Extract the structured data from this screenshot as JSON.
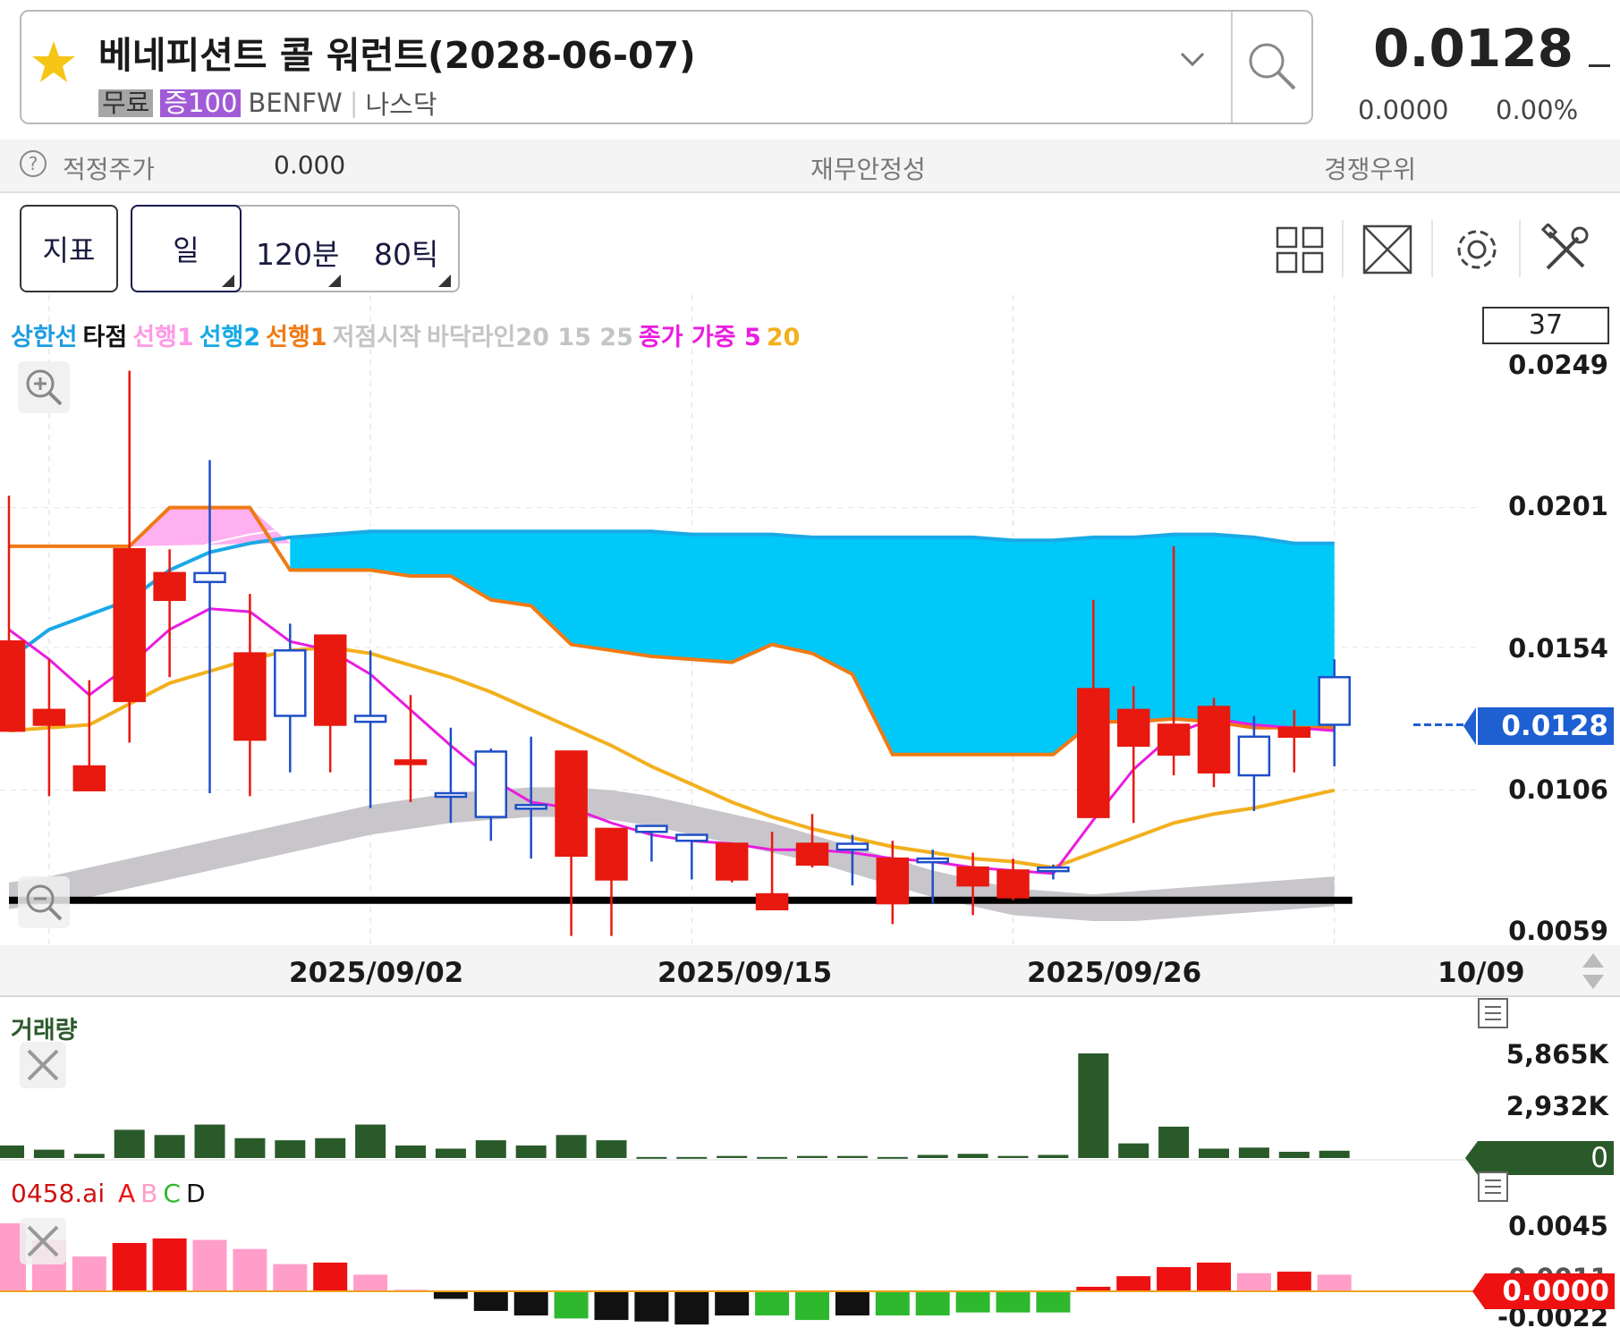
{
  "header": {
    "stock_name": "베네피션트 콜 워런트(2028-06-07)",
    "badge_free": "무료",
    "badge_margin": "증100",
    "ticker": "BENFW",
    "exchange": "나스닥",
    "price": "0.0128",
    "change_abs": "0.0000",
    "change_pct": "0.00%"
  },
  "info_strip": {
    "fair_value_label": "적정주가",
    "fair_value": "0.000",
    "financial_stability": "재무안정성",
    "competitive_edge": "경쟁우위"
  },
  "toolbar": {
    "indicator": "지표",
    "day": "일",
    "min120": "120분",
    "tick80": "80틱"
  },
  "legend": [
    {
      "text": "상한선",
      "color": "#1e9be0"
    },
    {
      "text": "타점",
      "color": "#111111"
    },
    {
      "text": "선행1",
      "color": "#ff99e6"
    },
    {
      "text": "선행2",
      "color": "#15a9e6"
    },
    {
      "text": "선행1",
      "color": "#f07a14"
    },
    {
      "text": "저점시작",
      "color": "#c4c4c4"
    },
    {
      "text": "바닥라인20 15 25",
      "color": "#c4c4c4"
    },
    {
      "text": "종가 가중 5",
      "color": "#ea1ce0"
    },
    {
      "text": "20",
      "color": "#f2b01e"
    }
  ],
  "candle_count": "37",
  "price_axis": [
    "0.0249",
    "0.0201",
    "0.0154",
    "0.0106",
    "0.0059"
  ],
  "current_price_tag": "0.0128",
  "date_axis": [
    "2025/09/02",
    "2025/09/15",
    "2025/09/26",
    "10/09"
  ],
  "volume": {
    "title": "거래량",
    "axis": [
      "5,865K",
      "2,932K",
      "0"
    ],
    "tag": "0"
  },
  "ai_panel": {
    "title_prefix": "0458.ai",
    "labels": [
      {
        "t": "A",
        "c": "#ee1111"
      },
      {
        "t": "B",
        "c": "#ff9ec8"
      },
      {
        "t": "C",
        "c": "#2eb82e"
      },
      {
        "t": "D",
        "c": "#111111"
      }
    ],
    "axis": [
      "0.0045",
      "0.0011",
      "-0.0022"
    ],
    "tag": "0.0000"
  },
  "chart_data": {
    "type": "candlestick",
    "price_range": [
      0.0059,
      0.0249
    ],
    "candles": [
      {
        "o": 0.0156,
        "h": 0.0205,
        "l": 0.0126,
        "c": 0.0126
      },
      {
        "o": 0.0133,
        "h": 0.015,
        "l": 0.0104,
        "c": 0.0128
      },
      {
        "o": 0.0114,
        "h": 0.0143,
        "l": 0.0106,
        "c": 0.0106
      },
      {
        "o": 0.0187,
        "h": 0.0247,
        "l": 0.0122,
        "c": 0.0136
      },
      {
        "o": 0.0179,
        "h": 0.0187,
        "l": 0.0144,
        "c": 0.017
      },
      {
        "o": 0.0176,
        "h": 0.0217,
        "l": 0.0105,
        "c": 0.0179
      },
      {
        "o": 0.0152,
        "h": 0.0172,
        "l": 0.0104,
        "c": 0.0123
      },
      {
        "o": 0.0131,
        "h": 0.0162,
        "l": 0.0112,
        "c": 0.0153
      },
      {
        "o": 0.0158,
        "h": 0.0158,
        "l": 0.0112,
        "c": 0.0128
      },
      {
        "o": 0.0129,
        "h": 0.0153,
        "l": 0.01,
        "c": 0.0131
      },
      {
        "o": 0.0116,
        "h": 0.0138,
        "l": 0.0102,
        "c": 0.0115
      },
      {
        "o": 0.0105,
        "h": 0.0127,
        "l": 0.0095,
        "c": 0.0105
      },
      {
        "o": 0.0097,
        "h": 0.012,
        "l": 0.0089,
        "c": 0.0119
      },
      {
        "o": 0.0101,
        "h": 0.0124,
        "l": 0.0083,
        "c": 0.0101
      },
      {
        "o": 0.0119,
        "h": 0.0119,
        "l": 0.0057,
        "c": 0.0084
      },
      {
        "o": 0.0093,
        "h": 0.0093,
        "l": 0.0057,
        "c": 0.0076
      },
      {
        "o": 0.0092,
        "h": 0.0094,
        "l": 0.0082,
        "c": 0.0094
      },
      {
        "o": 0.0089,
        "h": 0.0091,
        "l": 0.0076,
        "c": 0.0091
      },
      {
        "o": 0.0088,
        "h": 0.0088,
        "l": 0.0075,
        "c": 0.0076
      },
      {
        "o": 0.0071,
        "h": 0.0092,
        "l": 0.0067,
        "c": 0.0066
      },
      {
        "o": 0.0088,
        "h": 0.0098,
        "l": 0.008,
        "c": 0.0081
      },
      {
        "o": 0.0086,
        "h": 0.0091,
        "l": 0.0074,
        "c": 0.0088
      },
      {
        "o": 0.0083,
        "h": 0.0089,
        "l": 0.0061,
        "c": 0.0068
      },
      {
        "o": 0.0083,
        "h": 0.0086,
        "l": 0.0068,
        "c": 0.0083
      },
      {
        "o": 0.008,
        "h": 0.0085,
        "l": 0.0064,
        "c": 0.0074
      },
      {
        "o": 0.0079,
        "h": 0.0083,
        "l": 0.0069,
        "c": 0.007
      },
      {
        "o": 0.0079,
        "h": 0.0081,
        "l": 0.0076,
        "c": 0.008
      },
      {
        "o": 0.014,
        "h": 0.017,
        "l": 0.0099,
        "c": 0.0097
      },
      {
        "o": 0.0133,
        "h": 0.0141,
        "l": 0.0095,
        "c": 0.0121
      },
      {
        "o": 0.0128,
        "h": 0.0188,
        "l": 0.0111,
        "c": 0.0118
      },
      {
        "o": 0.0134,
        "h": 0.0137,
        "l": 0.0107,
        "c": 0.0112
      },
      {
        "o": 0.0111,
        "h": 0.0131,
        "l": 0.0099,
        "c": 0.0124
      },
      {
        "o": 0.0127,
        "h": 0.0133,
        "l": 0.0112,
        "c": 0.0124
      },
      {
        "o": 0.0128,
        "h": 0.015,
        "l": 0.0114,
        "c": 0.0144
      }
    ],
    "volume": [
      0.12,
      0.08,
      0.04,
      0.27,
      0.22,
      0.32,
      0.19,
      0.17,
      0.19,
      0.32,
      0.12,
      0.09,
      0.17,
      0.12,
      0.22,
      0.17,
      0.01,
      0.01,
      0.02,
      0.01,
      0.02,
      0.02,
      0.01,
      0.03,
      0.04,
      0.02,
      0.03,
      1.0,
      0.14,
      0.3,
      0.09,
      0.1,
      0.06,
      0.07
    ],
    "ai_values": [
      0.0045,
      0.0034,
      0.0023,
      0.0032,
      0.0035,
      0.0034,
      0.0028,
      0.0018,
      0.0019,
      0.0011,
      0.0001,
      -0.0005,
      -0.0013,
      -0.0016,
      -0.0018,
      -0.0019,
      -0.002,
      -0.0022,
      -0.0016,
      -0.0016,
      -0.0019,
      -0.0016,
      -0.0016,
      -0.0016,
      -0.0014,
      -0.0014,
      -0.0014,
      0.0003,
      0.001,
      0.0016,
      0.0019,
      0.0012,
      0.0013,
      0.0011
    ],
    "ai_colors": [
      "B",
      "B",
      "B",
      "A",
      "A",
      "B",
      "B",
      "B",
      "A",
      "B",
      "B",
      "D",
      "D",
      "D",
      "C",
      "D",
      "D",
      "D",
      "D",
      "C",
      "C",
      "D",
      "C",
      "C",
      "C",
      "C",
      "C",
      "A",
      "A",
      "A",
      "A",
      "B",
      "A",
      "B"
    ]
  }
}
